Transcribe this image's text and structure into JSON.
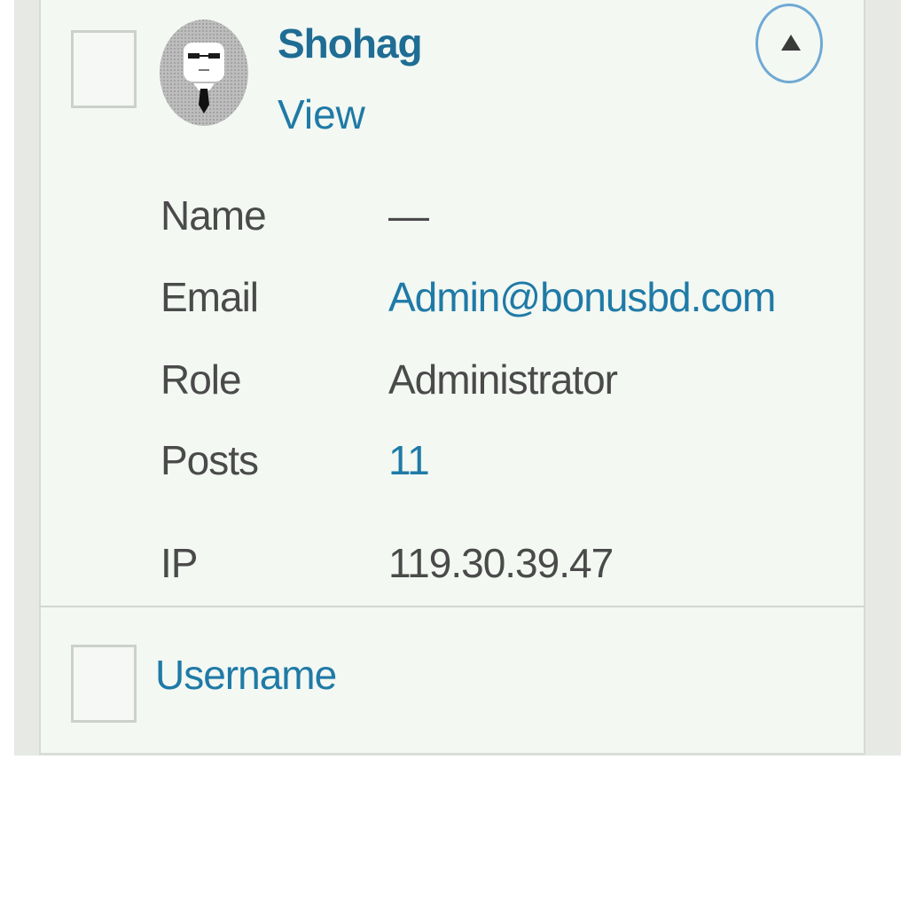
{
  "user": {
    "username": "Shohag",
    "view_label": "View",
    "avatar_icon": "incognito-avatar-icon",
    "toggle_icon": "caret-up-icon"
  },
  "details": [
    {
      "label": "Name",
      "value": "—"
    },
    {
      "label": "Email",
      "value": "Admin@bonusbd.com"
    },
    {
      "label": "Role",
      "value": "Administrator"
    },
    {
      "label": "Posts",
      "value": "11"
    },
    {
      "label": "IP",
      "value": "119.30.39.47"
    }
  ],
  "footer": {
    "column_label": "Username"
  },
  "colors": {
    "link": "#1f7aa6",
    "background": "#f3f8f3",
    "toggle_border": "#6fa9d4"
  }
}
